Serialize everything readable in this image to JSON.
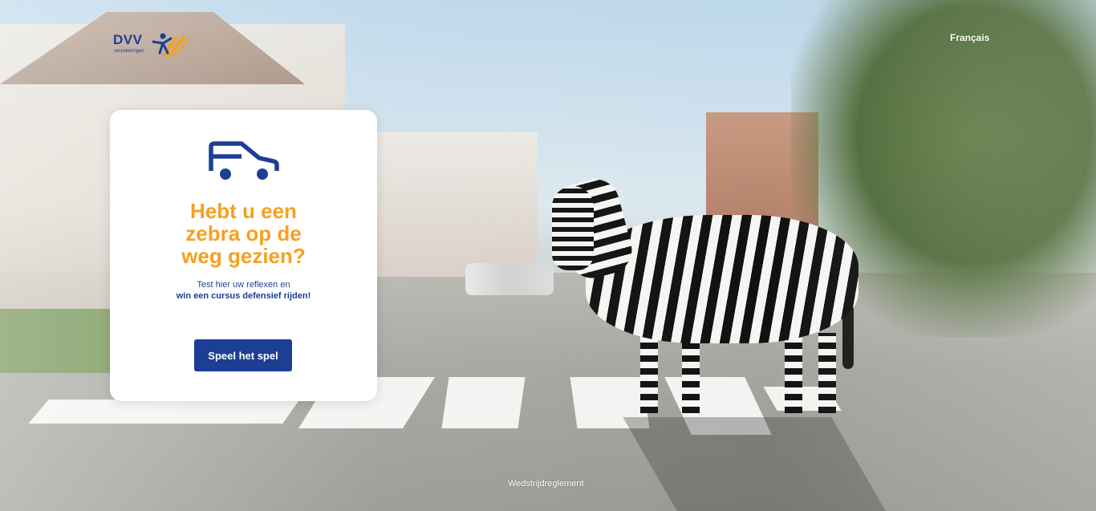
{
  "header": {
    "logo_text": "DVV",
    "logo_subtext": "verzekeringen",
    "language_link": "Français"
  },
  "card": {
    "icon": "car-icon",
    "title_lines": [
      "Hebt u een",
      "zebra op de",
      "weg gezien?"
    ],
    "subtitle_line1": "Test hier uw reflexen en",
    "subtitle_line2": "win een cursus defensief rijden!",
    "button_label": "Speel het spel"
  },
  "footer": {
    "rules_link": "Wedstrijdreglement"
  },
  "colors": {
    "brand_blue": "#1c3f94",
    "accent_orange": "#f5a022",
    "card_bg": "#ffffff"
  }
}
